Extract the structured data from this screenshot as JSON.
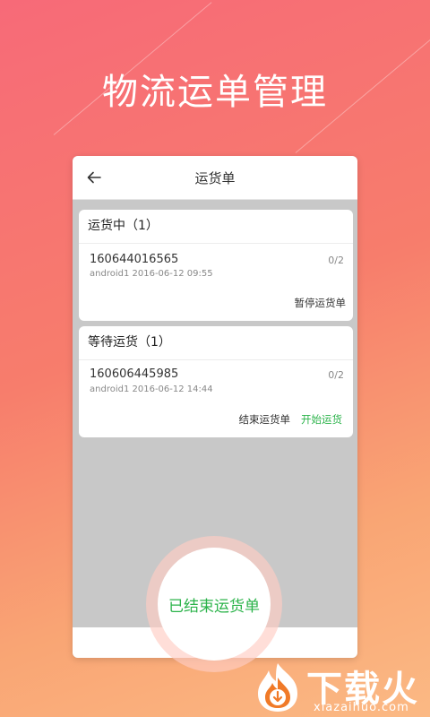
{
  "headline": "物流运单管理",
  "app": {
    "title": "运货单",
    "sections": [
      {
        "header": "运货中（1）",
        "order_no": "160644016565",
        "meta": "android1  2016-06-12  09:55",
        "count": "0/2",
        "actions": [
          "暂停运货单"
        ]
      },
      {
        "header": "等待运货（1）",
        "order_no": "160606445985",
        "meta": "android1  2016-06-12  14:44",
        "count": "0/2",
        "actions": [
          "结束运货单",
          "开始运货"
        ]
      }
    ]
  },
  "finished_button": "已结束运货单",
  "watermark": {
    "name": "下载火",
    "url": "xiazaihuo.com"
  },
  "colors": {
    "accent_green": "#2bb34a",
    "bg_top": "#f76a78",
    "bg_bottom": "#fbb984"
  },
  "icons": [
    "back-arrow-icon",
    "flame-logo-icon"
  ]
}
